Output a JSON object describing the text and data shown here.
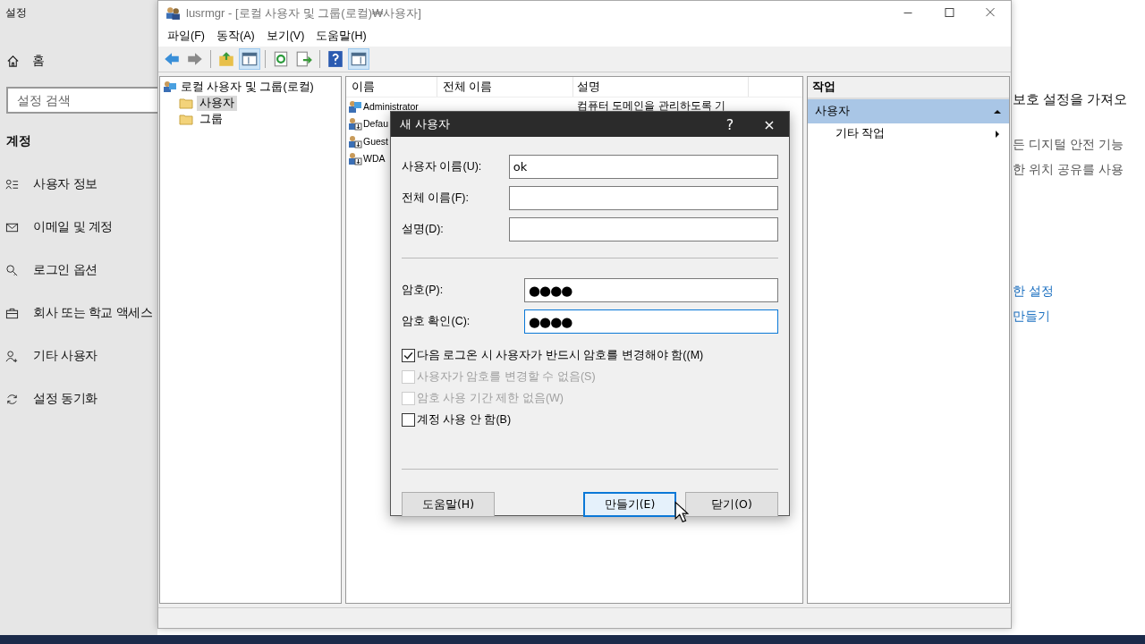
{
  "settings": {
    "title": "설정",
    "home": "홈",
    "search": {
      "placeholder": "설정 검색"
    },
    "section": "계정",
    "nav": [
      {
        "kind": "user-info",
        "label": "사용자 정보"
      },
      {
        "kind": "mail",
        "label": "이메일 및 계정"
      },
      {
        "kind": "key",
        "label": "로그인 옵션"
      },
      {
        "kind": "briefcase",
        "label": "회사 또는 학교 액세스"
      },
      {
        "kind": "person-add",
        "label": "기타 사용자"
      },
      {
        "kind": "sync",
        "label": "설정 동기화"
      }
    ],
    "right_texts": [
      {
        "kind": "heading",
        "text": "보호 설정을 가져오"
      },
      {
        "kind": "body",
        "text": "든 디지털 안전 기능"
      },
      {
        "kind": "body",
        "text": "한 위치 공유를 사용"
      },
      {
        "kind": "link",
        "text": "한 설정"
      },
      {
        "kind": "link",
        "text": "만들기"
      }
    ]
  },
  "window": {
    "title": "lusrmgr - [로컬 사용자 및 그룹(로컬)₩사용자]",
    "menu": [
      "파일(F)",
      "동작(A)",
      "보기(V)",
      "도움말(H)"
    ],
    "tree": {
      "label": "로컬 사용자 및 그룹(로컬)",
      "children": [
        {
          "label": "사용자",
          "selected": true
        },
        {
          "label": "그룹",
          "selected": false
        }
      ]
    },
    "table": {
      "columns": [
        "이름",
        "전체 이름",
        "설명"
      ],
      "rows": [
        {
          "name": "Administrator",
          "description": "컴퓨터 도메인을 관리하도록 기",
          "kind": "admin"
        },
        {
          "name": "Defau",
          "kind": "disabled"
        },
        {
          "name": "Guest",
          "kind": "disabled"
        },
        {
          "name": "WDA",
          "kind": "disabled"
        }
      ]
    },
    "actions": {
      "title": "작업",
      "section": {
        "label": "사용자",
        "expanded": true
      },
      "items": [
        "기타 작업"
      ]
    }
  },
  "dialog": {
    "title": "새 사용자",
    "help": "?",
    "close": "×",
    "fields": [
      {
        "label": "사용자 이름(U):",
        "value": "ok",
        "focused": false,
        "kind": "text"
      },
      {
        "label": "전체 이름(F):",
        "focused": false,
        "kind": "text"
      },
      {
        "label": "설명(D):",
        "focused": false,
        "kind": "text"
      },
      {
        "label": "암호(P):",
        "value": "●●●●",
        "focused": false,
        "kind": "password"
      },
      {
        "label": "암호 확인(C):",
        "value": "●●●●",
        "focused": true,
        "kind": "password"
      }
    ],
    "checkboxes": [
      {
        "label": "다음 로그온 시 사용자가 반드시 암호를 변경해야 함((M)",
        "checked": true,
        "disabled": false
      },
      {
        "label": "사용자가 암호를 변경할 수 없음(S)",
        "checked": false,
        "disabled": true
      },
      {
        "label": "암호 사용 기간 제한 없음(W)",
        "checked": false,
        "disabled": true
      },
      {
        "label": "계정 사용 안 함(B)",
        "checked": false,
        "disabled": false
      }
    ],
    "buttons": [
      {
        "label": "도움말(H)",
        "default": false
      },
      {
        "label": "만들기(E)",
        "default": true
      },
      {
        "label": "닫기(O)",
        "default": false
      }
    ]
  }
}
